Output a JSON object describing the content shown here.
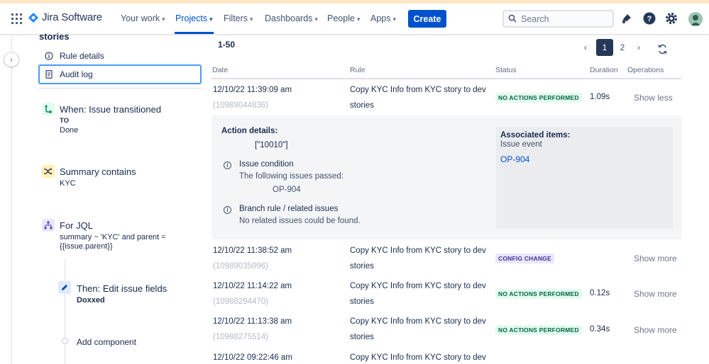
{
  "nav": {
    "product_name": "Jira Software",
    "your_work": "Your work",
    "projects": "Projects",
    "filters": "Filters",
    "dashboards": "Dashboards",
    "people": "People",
    "apps": "Apps",
    "create": "Create",
    "search_placeholder": "Search",
    "accent_color": "#0052cc"
  },
  "sidebar": {
    "title": "stories",
    "items": [
      {
        "label": "Rule details",
        "icon": "info-icon"
      },
      {
        "label": "Audit log",
        "icon": "document-icon",
        "selected": true
      }
    ],
    "rule_components": [
      {
        "icon": "transition-icon",
        "title": "When: Issue transitioned",
        "sub_label": "TO",
        "sub_value": "Done"
      },
      {
        "icon": "shuffle-icon",
        "title": "Summary contains",
        "sub_value": "KYC"
      },
      {
        "icon": "branch-icon",
        "title": "For JQL",
        "sub_value": "summary ~ 'KYC' and parent = {{issue.parent}}"
      },
      {
        "icon": "edit-icon",
        "title": "Then: Edit issue fields",
        "sub_value": "Doxxed"
      }
    ],
    "add_component": "Add component"
  },
  "audit": {
    "range": "1-50",
    "pages": [
      "1",
      "2"
    ],
    "current_page": "1",
    "columns": [
      "Date",
      "Rule",
      "Status",
      "Duration",
      "Operations"
    ],
    "rows": [
      {
        "date": "12/10/22 11:39:09 am",
        "id": "(10989044836)",
        "rule_line1": "Copy KYC Info from KYC story to dev",
        "rule_line2": "stories",
        "status": "NO ACTIONS PERFORMED",
        "status_color": "green",
        "duration": "1.09s",
        "operation": "Show less"
      },
      {
        "date": "12/10/22 11:38:52 am",
        "id": "(10989035096)",
        "rule_line1": "Copy KYC Info from KYC story to dev",
        "rule_line2": "stories",
        "status": "CONFIG CHANGE",
        "status_color": "purple",
        "duration": "",
        "operation": "Show more"
      },
      {
        "date": "12/10/22 11:14:22 am",
        "id": "(10988294470)",
        "rule_line1": "Copy KYC Info from KYC story to dev",
        "rule_line2": "stories",
        "status": "NO ACTIONS PERFORMED",
        "status_color": "green",
        "duration": "0.12s",
        "operation": "Show more"
      },
      {
        "date": "12/10/22 11:13:38 am",
        "id": "(10988275514)",
        "rule_line1": "Copy KYC Info from KYC story to dev",
        "rule_line2": "stories",
        "status": "NO ACTIONS PERFORMED",
        "status_color": "green",
        "duration": "0.34s",
        "operation": "Show more"
      },
      {
        "date": "12/10/22 09:22:46 am",
        "rule_line1": "Copy KYC Info from KYC story to dev"
      }
    ],
    "details": {
      "heading": "Action details:",
      "value": "[\"10010\"]",
      "condition_title": "Issue condition",
      "condition_text": "The following issues passed:",
      "condition_issue": "OP-904",
      "branch_title": "Branch rule / related issues",
      "branch_text": "No related issues could be found.",
      "assoc_heading": "Associated items:",
      "assoc_type": "Issue event",
      "assoc_link": "OP-904"
    }
  }
}
